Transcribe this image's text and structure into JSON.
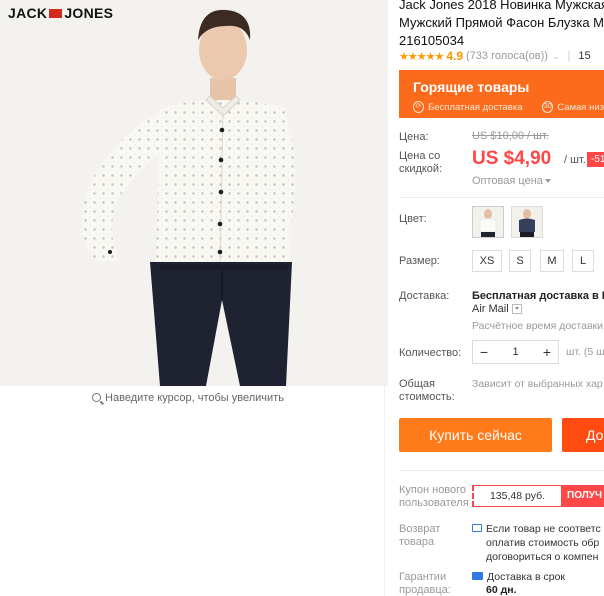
{
  "gallery": {
    "brand_logo_left": "JACK",
    "brand_logo_right": "JONES",
    "zoom_hint": "Наведите курсор, чтобы увеличить"
  },
  "product": {
    "title_lines": [
      "Jack Jones 2018 Новинка Мужская",
      "Мужский Прямой Фасон Блузка М",
      "216105034"
    ],
    "rating_stars": "★★★★★",
    "rating_value": "4.9",
    "rating_count": "(733 голоса(ов))",
    "orders": "15"
  },
  "hot_banner": {
    "title": "Горящие товары",
    "badge1": "Бесплатная доставка",
    "badge2": "Самая низ",
    "badge2_num": "30"
  },
  "pricing": {
    "price_label": "Цена:",
    "old_price": "US $10,00 / шт.",
    "discount_label_1": "Цена со",
    "discount_label_2": "скидкой:",
    "price": "US $4,90",
    "unit": "/ шт.",
    "discount_pct": "-51",
    "wholesale": "Оптовая цена"
  },
  "options": {
    "color_label": "Цвет:",
    "size_label": "Размер:",
    "sizes": [
      "XS",
      "S",
      "M",
      "L"
    ]
  },
  "shipping": {
    "label": "Доставка:",
    "main": "Бесплатная доставка в R",
    "method": "Air Mail",
    "estimate": "Расчётное время доставки"
  },
  "quantity": {
    "label": "Количество:",
    "minus": "−",
    "value": "1",
    "plus": "+",
    "unit_note": "шт. (5 ш"
  },
  "total": {
    "label_1": "Общая",
    "label_2": "стоимость:",
    "note": "Зависит от выбранных хар"
  },
  "actions": {
    "buy_now": "Купить сейчас",
    "add_to_cart": "До"
  },
  "coupon": {
    "label_1": "Купон нового",
    "label_2": "пользователя",
    "amount": "135,48 руб.",
    "get": "ПОЛУЧ"
  },
  "returns": {
    "label_1": "Возврат",
    "label_2": "товара",
    "line1": "Если товар не соответс",
    "line2": "оплатив стоимость обр",
    "line3": "договориться о компен"
  },
  "guarantee": {
    "label_1": "Гарантии",
    "label_2": "продавца:",
    "line1": "Доставка в срок",
    "line2": "60 дн."
  },
  "colors": {
    "accent_orange": "#fb6b1b",
    "price_red": "#ff4747",
    "buy_orange": "#ff7a19",
    "cart_red": "#ff4b12",
    "star_orange": "#ff9800"
  }
}
